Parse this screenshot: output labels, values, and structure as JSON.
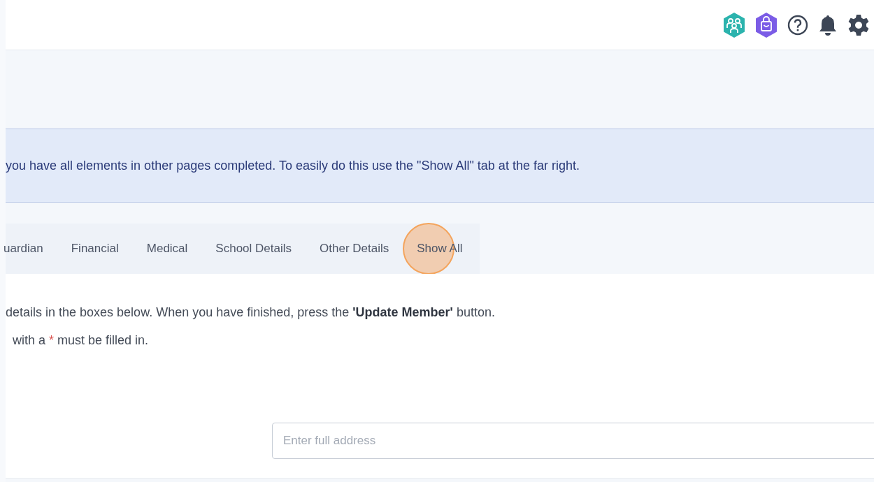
{
  "header": {
    "icons": [
      {
        "kind": "team"
      },
      {
        "kind": "shop"
      },
      {
        "kind": "help"
      },
      {
        "kind": "notifications"
      },
      {
        "kind": "settings"
      }
    ]
  },
  "banner": {
    "text": "you have all elements in other pages completed. To easily do this use the \"Show All\" tab at the far right."
  },
  "tabs": [
    {
      "label": "uardian",
      "highlighted": false
    },
    {
      "label": "Financial",
      "highlighted": false
    },
    {
      "label": "Medical",
      "highlighted": false
    },
    {
      "label": "School Details",
      "highlighted": false
    },
    {
      "label": "Other Details",
      "highlighted": false
    },
    {
      "label": "Show All",
      "highlighted": true
    }
  ],
  "instructions": "details in the boxes below. When you have finished, press the **'Update Member'** button.",
  "required_note": {
    "before": "with a",
    "mark": "*",
    "after": "must be filled in."
  },
  "address_field": {
    "placeholder": "Enter full address"
  }
}
